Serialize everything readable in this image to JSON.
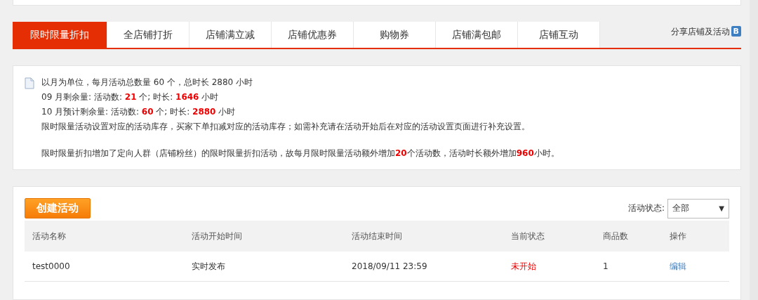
{
  "tabs": [
    {
      "label": "限时限量折扣",
      "selected": true
    },
    {
      "label": "全店铺打折",
      "selected": false
    },
    {
      "label": "店铺满立减",
      "selected": false
    },
    {
      "label": "店铺优惠券",
      "selected": false
    },
    {
      "label": "购物券",
      "selected": false
    },
    {
      "label": "店铺满包邮",
      "selected": false
    },
    {
      "label": "店铺互动",
      "selected": false
    }
  ],
  "share_link": "分享店铺及活动",
  "share_badge": "B",
  "info": {
    "lines": [
      "以月为单位，每月活动总数量 60 个，总时长 2880 小时",
      "09 月剩余量: 活动数: **21** 个; 时长: **1646** 小时",
      "10 月预计剩余量: 活动数: **60** 个; 时长: **2880** 小时",
      "限时限量活动设置对应的活动库存，买家下单扣减对应的活动库存；如需补充请在活动开始后在对应的活动设置页面进行补充设置。"
    ],
    "note": "限时限量折扣增加了定向人群（店铺粉丝）的限时限量折扣活动，故每月限时限量活动额外增加**20**个活动数，活动时长额外增加**960**小时。"
  },
  "create_button": "创建活动",
  "status_filter": {
    "label": "活动状态:",
    "value": "全部",
    "caret": "▼"
  },
  "table": {
    "columns": [
      "活动名称",
      "活动开始时间",
      "活动结束时间",
      "当前状态",
      "商品数",
      "操作"
    ],
    "rows": [
      {
        "name": "test0000",
        "start": "实时发布",
        "end": "2018/09/11 23:59",
        "status": "未开始",
        "count": "1",
        "action": "编辑"
      }
    ]
  }
}
